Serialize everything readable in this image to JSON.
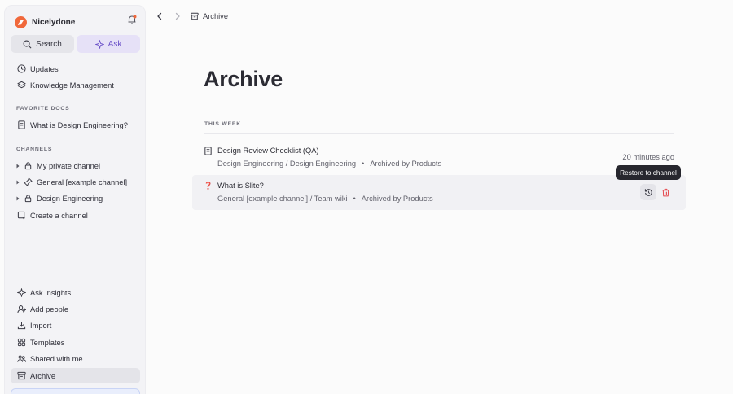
{
  "workspace": {
    "name": "Nicelydone"
  },
  "sidebar": {
    "search_label": "Search",
    "ask_label": "Ask",
    "top_items": [
      {
        "label": "Updates",
        "icon": "clock-icon"
      },
      {
        "label": "Knowledge Management",
        "icon": "layers-icon"
      }
    ],
    "favorites_label": "FAVORITE DOCS",
    "favorites": [
      {
        "label": "What is Design Engineering?",
        "icon": "doc-icon"
      }
    ],
    "channels_label": "CHANNELS",
    "channels": [
      {
        "label": "My private channel",
        "icon": "lock-icon"
      },
      {
        "label": "General [example channel]",
        "icon": "pin-icon"
      },
      {
        "label": "Design Engineering",
        "icon": "lock-icon"
      }
    ],
    "create_channel_label": "Create a channel",
    "bottom_items": [
      {
        "label": "Ask Insights",
        "icon": "sparkle-icon"
      },
      {
        "label": "Add people",
        "icon": "user-plus-icon"
      },
      {
        "label": "Import",
        "icon": "download-icon"
      },
      {
        "label": "Templates",
        "icon": "templates-icon"
      },
      {
        "label": "Shared with me",
        "icon": "people-icon"
      },
      {
        "label": "Archive",
        "icon": "archive-icon"
      }
    ]
  },
  "topbar": {
    "breadcrumb": "Archive"
  },
  "main": {
    "title": "Archive",
    "section_label": "THIS WEEK",
    "rows": [
      {
        "title": "Design Review Checklist (QA)",
        "path": "Design Engineering / Design Engineering",
        "dot": "•",
        "archived_by": "Archived by Products",
        "time": "20 minutes ago"
      },
      {
        "title": "What is Slite?",
        "path": "General [example channel] / Team wiki",
        "dot": "•",
        "archived_by": "Archived by Products",
        "emoji": "❓"
      }
    ],
    "tooltip": "Restore to channel"
  },
  "colors": {
    "brand": "#f0683b",
    "accent": "#6b51c9",
    "danger": "#e5484d"
  }
}
